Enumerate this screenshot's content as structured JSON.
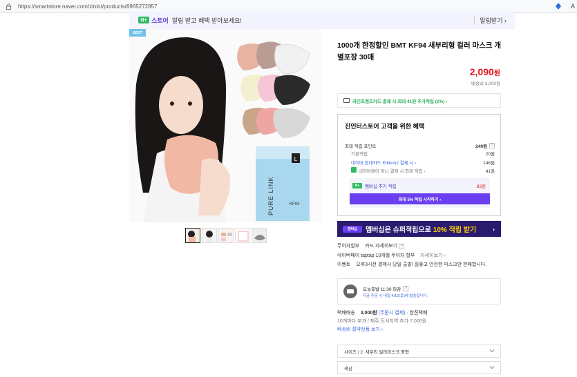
{
  "browser": {
    "url": "https://smartstore.naver.com/zinint/products/6965272857",
    "ext_label": "A"
  },
  "banner": {
    "nplus": "N+",
    "store": "스토어",
    "text": "알림 받고 혜택 받아보세요!",
    "right": "알림받기 ›"
  },
  "product": {
    "best_badge": "BEST",
    "title": "1000개 한정할인 BMT KF94 새부리형 컬러 마스크 개별포장 30매",
    "price": "2,090",
    "price_unit": "원",
    "shipping_mini": "배송비 3,000원",
    "box_text": "PURE LINK",
    "box_kf": "KF94",
    "box_size": "L"
  },
  "card_promo": "라인프렌즈카드 결제 시 최대 41원 추가적립 (2%) ›",
  "benefit": {
    "title": "진인터스토어 고객을 위한 혜택",
    "rows": [
      {
        "label": "최대 적립 포인트",
        "value": "249원"
      },
      {
        "label": "기본적립",
        "value": "20원"
      },
      {
        "label": "네이버 현대카드 Edition2 결제 시 ›",
        "value": "146원"
      },
      {
        "label": "네이버페이 머니 결제 시 최대 적립 ›",
        "value": "41원"
      }
    ],
    "membership_label": "멤버십 추가 적립",
    "membership_value": "83원",
    "membership_button": "최대 5% 적립 시작하기 ›"
  },
  "super_banner": {
    "pill": "멤버십",
    "text": "멤버십은 슈퍼적립으로",
    "highlight": "10% 적립 받기",
    "chev": "›"
  },
  "info_lines": [
    {
      "k": "무이자할부",
      "v": "카드 자세히보기"
    },
    {
      "k": "네이버페이 taptap 10개월 무이자 할부",
      "v": "자세히보기 ›"
    },
    {
      "k": "이벤트",
      "v": "오후3시전 결제시 당일 출발! 질좋고 안전한 마스크만 판매합니다."
    }
  ],
  "delivery": {
    "line1": "오늘출발 11:30 마감",
    "line2": "지금 주문 시 내일 4/15(토)에 발송됩니다."
  },
  "ship": {
    "label": "택배배송",
    "fee": "3,000원",
    "cond": "(주문시 결제)",
    "carrier": "· 한진택배",
    "line2": "10개마다 부과 / 제주,도서지역 추가 7,000원",
    "line3": "배송비 절약상품 보기 ›"
  },
  "options": [
    {
      "label": "사이즈 / 2. 새부리 컬러마스크 중형"
    },
    {
      "label": "색상"
    }
  ]
}
